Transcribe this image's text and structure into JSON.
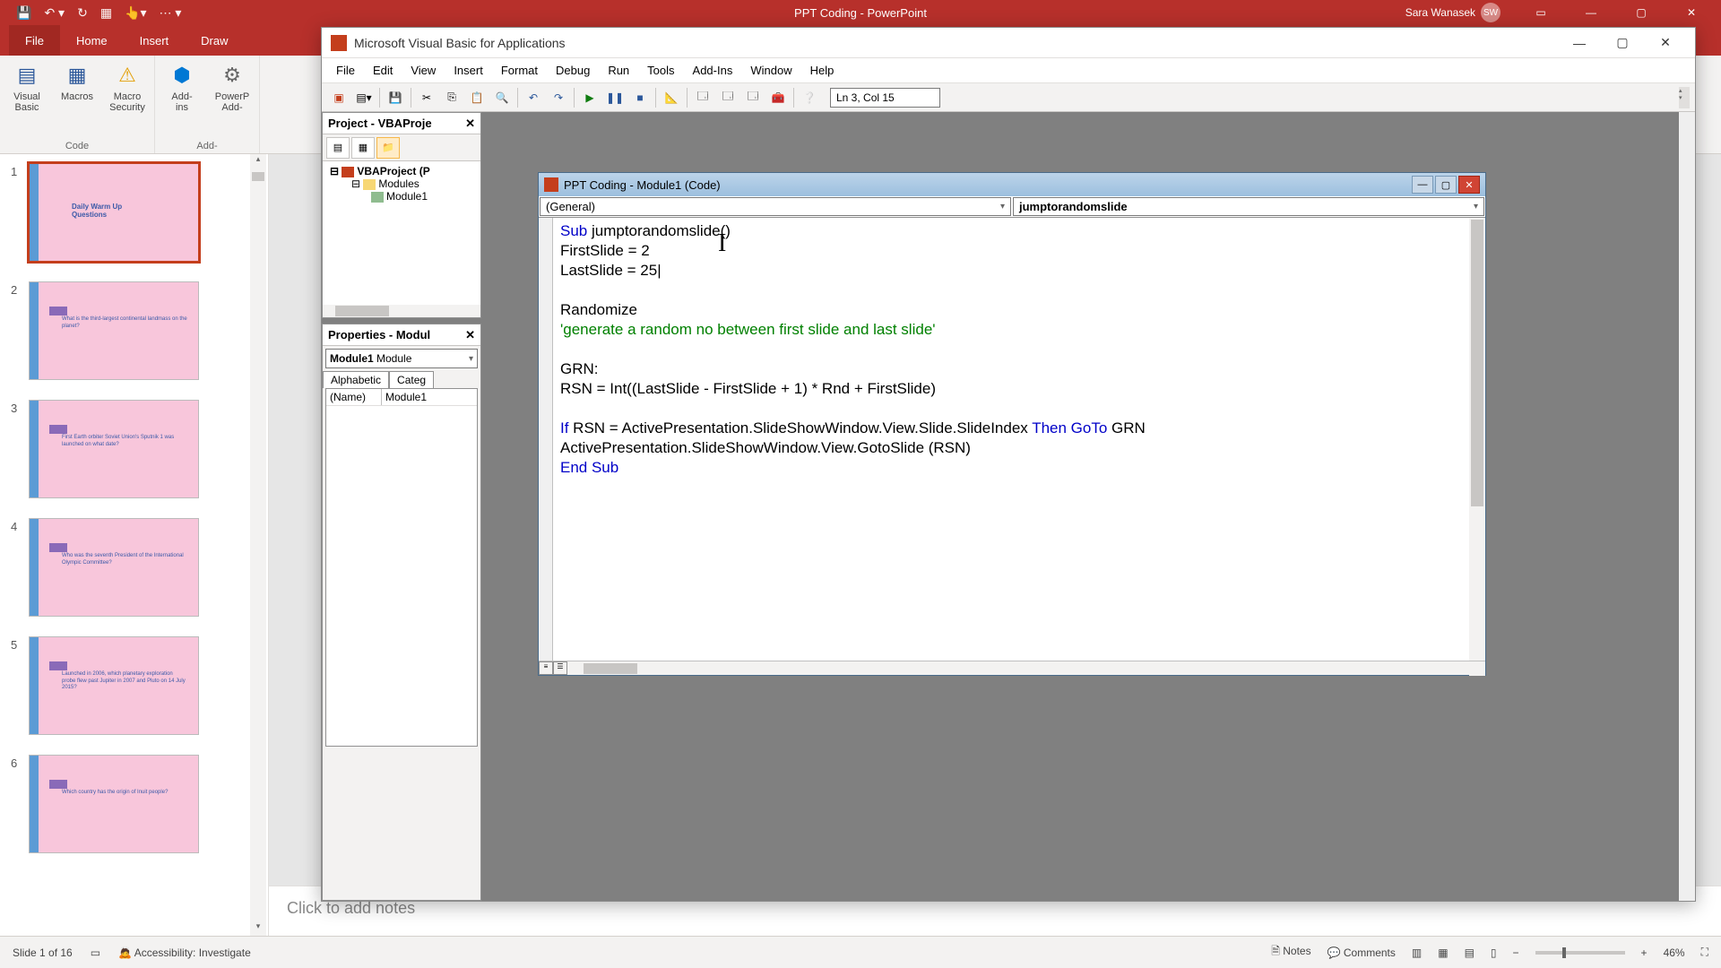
{
  "ppt": {
    "qat_save": "💾",
    "doc_title": "PPT Coding  -  PowerPoint",
    "user_name": "Sara Wanasek",
    "user_initials": "SW",
    "tabs": {
      "file": "File",
      "home": "Home",
      "insert": "Insert",
      "draw": "Draw"
    },
    "ribbon": {
      "visual_basic": "Visual\nBasic",
      "macros": "Macros",
      "macro_security": "Macro\nSecurity",
      "code_label": "Code",
      "addins": "Add-\nins",
      "ppt_addins": "PowerP\nAdd-",
      "addins_label": "Add-"
    },
    "thumbs": [
      {
        "n": "1",
        "title": "Daily Warm Up Questions",
        "sel": true
      },
      {
        "n": "2",
        "q": "What is the third-largest continental landmass on the planet?"
      },
      {
        "n": "3",
        "q": "First Earth orbiter Soviet Union's Sputnik 1 was launched on what date?"
      },
      {
        "n": "4",
        "q": "Who was the seventh President of the International Olympic Committee?"
      },
      {
        "n": "5",
        "q": "Launched in 2006, which planetary exploration probe flew past Jupiter in 2007 and Pluto on 14 July 2015?"
      },
      {
        "n": "6",
        "q": "Which country has the origin of Inuit people?"
      }
    ],
    "notes_placeholder": "Click to add notes",
    "status": {
      "slide": "Slide 1 of 16",
      "accessibility": "Accessibility: Investigate",
      "notes": "Notes",
      "comments": "Comments",
      "zoom": "46%"
    }
  },
  "vba": {
    "title": "Microsoft Visual Basic for Applications",
    "menu": {
      "file": "File",
      "edit": "Edit",
      "view": "View",
      "insert": "Insert",
      "format": "Format",
      "debug": "Debug",
      "run": "Run",
      "tools": "Tools",
      "addins": "Add-Ins",
      "window": "Window",
      "help": "Help"
    },
    "toolbar_pos": "Ln 3, Col 15",
    "project": {
      "panel_title": "Project - VBAProje",
      "root": "VBAProject (P",
      "modules": "Modules",
      "module1": "Module1"
    },
    "properties": {
      "panel_title": "Properties - Modul",
      "combo_name": "Module1",
      "combo_type": "Module",
      "tab_alpha": "Alphabetic",
      "tab_categ": "Categ",
      "row_name_label": "(Name)",
      "row_name_value": "Module1"
    },
    "code_window": {
      "title": "PPT Coding - Module1 (Code)",
      "combo_left": "(General)",
      "combo_right": "jumptorandomslide",
      "lines": {
        "l1a": "Sub",
        "l1b": " jumptorandomslide()",
        "l2": "FirstSlide = 2",
        "l3": "LastSlide = 25",
        "l5": "Randomize",
        "l6": "'generate a random no between first slide and last slide'",
        "l8": "GRN:",
        "l9": "RSN = Int((LastSlide - FirstSlide + 1) * Rnd + FirstSlide)",
        "l11a": "If",
        "l11b": " RSN = ActivePresentation.SlideShowWindow.View.Slide.SlideIndex ",
        "l11c": "Then",
        "l11d": " GoTo",
        "l11e": " GRN",
        "l12": "ActivePresentation.SlideShowWindow.View.GotoSlide (RSN)",
        "l13": "End Sub"
      }
    }
  }
}
